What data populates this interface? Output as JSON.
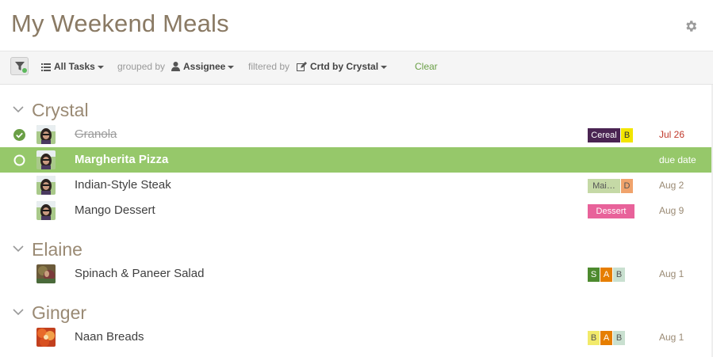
{
  "header": {
    "title": "My Weekend Meals",
    "settings_icon": "gear-icon"
  },
  "toolbar": {
    "filter_icon": "funnel-icon",
    "view_label": "All Tasks",
    "grouped_by_label": "grouped by",
    "group_value": "Assignee",
    "filtered_by_label": "filtered by",
    "filter_value": "Crtd by Crystal",
    "clear_label": "Clear"
  },
  "colors": {
    "accent_green": "#96c86a",
    "check_green": "#6a9f46",
    "title_brown": "#8a7a64",
    "overdue_red": "#c0392b"
  },
  "groups": [
    {
      "name": "Crystal",
      "tasks": [
        {
          "name": "Granola",
          "done": true,
          "selected": false,
          "tags": [
            {
              "label": "Cereal",
              "bg": "#4a2452",
              "fg": "#ffffff"
            },
            {
              "label": "B",
              "bg": "#f2e500",
              "fg": "#333333"
            }
          ],
          "date": "Jul 26",
          "avatar": "crystal"
        },
        {
          "name": "Margherita Pizza",
          "done": false,
          "selected": true,
          "tags": [],
          "date": "due date",
          "avatar": "crystal"
        },
        {
          "name": "Indian-Style Steak",
          "done": false,
          "selected": false,
          "tags": [
            {
              "label": "Mai…",
              "bg": "#c5d9a6",
              "fg": "#555555"
            },
            {
              "label": "D",
              "bg": "#f0a36c",
              "fg": "#555555"
            }
          ],
          "date": "Aug 2",
          "avatar": "crystal"
        },
        {
          "name": "Mango Dessert",
          "done": false,
          "selected": false,
          "tags": [
            {
              "label": "Dessert",
              "bg": "#e8629a",
              "fg": "#ffffff"
            }
          ],
          "date": "Aug 9",
          "avatar": "crystal"
        }
      ]
    },
    {
      "name": "Elaine",
      "tasks": [
        {
          "name": "Spinach & Paneer Salad",
          "done": false,
          "selected": false,
          "tags": [
            {
              "label": "S",
              "bg": "#4d8a2e",
              "fg": "#ffffff"
            },
            {
              "label": "A",
              "bg": "#e67e00",
              "fg": "#ffffff"
            },
            {
              "label": "B",
              "bg": "#c9e0d0",
              "fg": "#555555"
            }
          ],
          "date": "Aug 1",
          "avatar": "elaine"
        }
      ]
    },
    {
      "name": "Ginger",
      "tasks": [
        {
          "name": "Naan Breads",
          "done": false,
          "selected": false,
          "tags": [
            {
              "label": "B",
              "bg": "#f2ea6a",
              "fg": "#555555"
            },
            {
              "label": "A",
              "bg": "#e67e00",
              "fg": "#ffffff"
            },
            {
              "label": "B",
              "bg": "#c9e0d0",
              "fg": "#555555"
            }
          ],
          "date": "Aug 1",
          "avatar": "ginger"
        }
      ]
    }
  ]
}
